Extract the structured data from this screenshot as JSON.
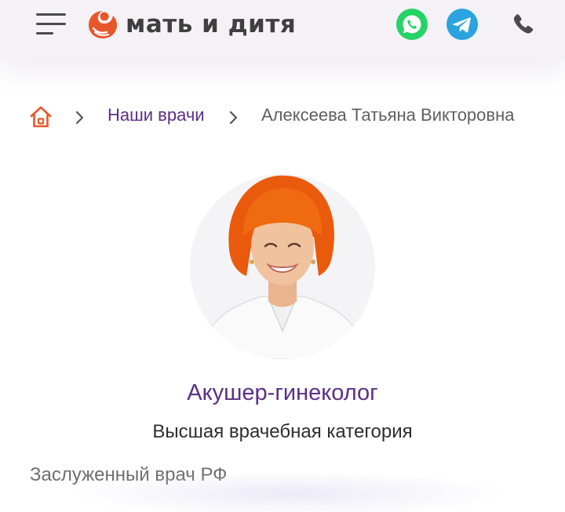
{
  "header": {
    "logo_text": "мать и дитя",
    "logo_icon": "mother-child-logo-icon",
    "menu_icon": "hamburger-menu-icon",
    "whatsapp_icon": "whatsapp-icon",
    "telegram_icon": "telegram-icon",
    "phone_icon": "phone-icon"
  },
  "breadcrumb": {
    "home_icon": "home-icon",
    "link_label": "Наши врачи",
    "current_label": "Алексеева Татьяна Викторовна"
  },
  "doctor": {
    "photo": "doctor-photo",
    "specialty": "Акушер-гинеколог",
    "category": "Высшая врачебная категория",
    "title": "Заслуженный врач РФ"
  },
  "colors": {
    "brand_orange": "#e8572a",
    "brand_purple": "#5b2f86",
    "whatsapp_green": "#25d366",
    "telegram_blue": "#2aa3df"
  }
}
